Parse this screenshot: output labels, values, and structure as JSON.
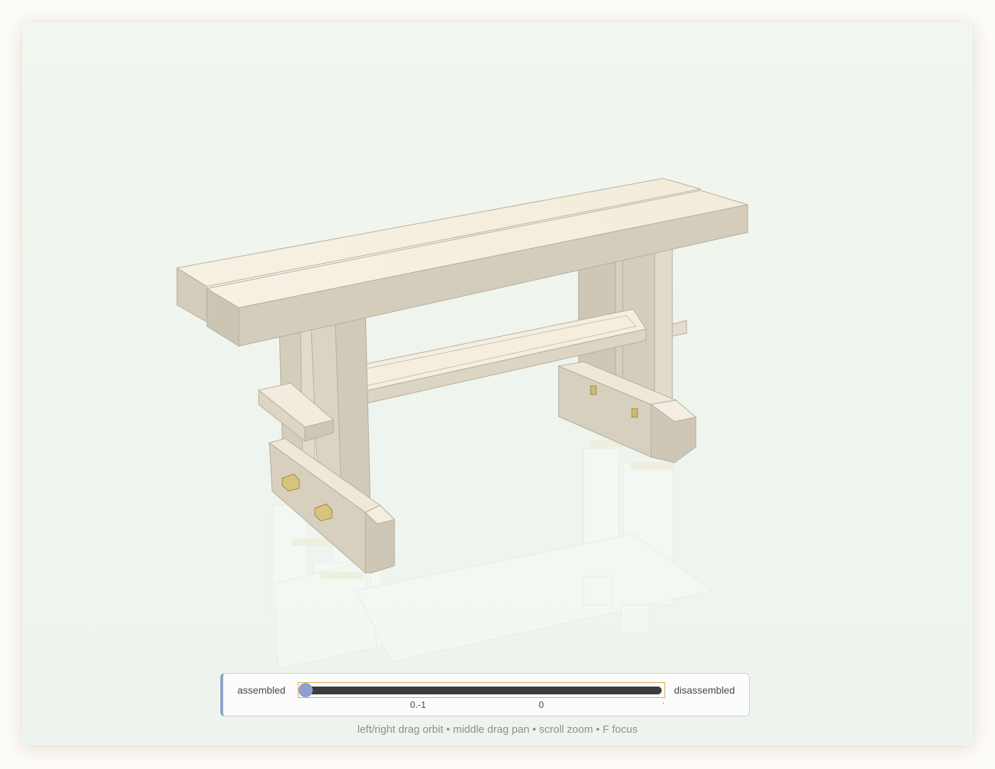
{
  "viewer": {
    "model_name": "bench-3d-model",
    "background_color": "#eef5ee",
    "wood_color": "#f5eedf",
    "peg_color": "#e8d9a0"
  },
  "slider": {
    "left_label": "assembled",
    "right_label": "disassembled",
    "value": 0,
    "ticks": [
      "0.-1",
      "0",
      "."
    ]
  },
  "hint": "left/right drag orbit • middle drag pan • scroll zoom • F focus"
}
